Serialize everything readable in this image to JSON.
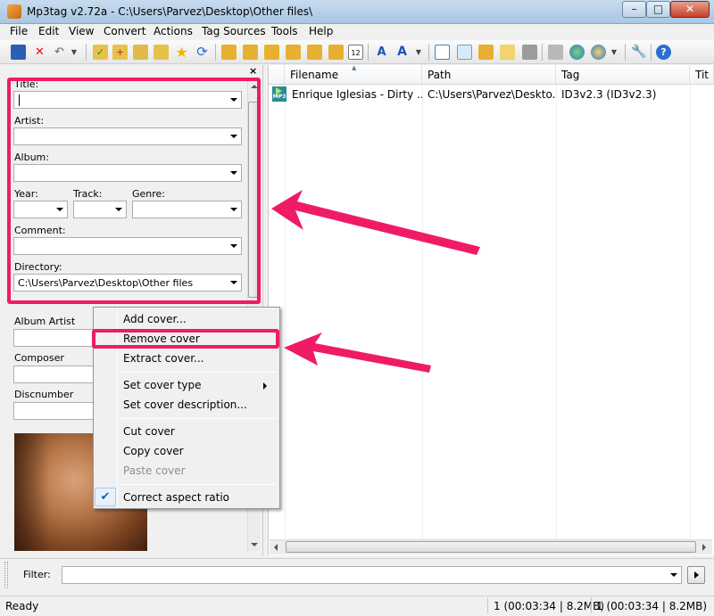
{
  "window": {
    "title": "Mp3tag v2.72a  -  C:\\Users\\Parvez\\Desktop\\Other files\\",
    "minimize_glyph": "–",
    "maximize_glyph": "□",
    "close_glyph": "✕"
  },
  "menu": [
    "File",
    "Edit",
    "View",
    "Convert",
    "Actions",
    "Tag Sources",
    "Tools",
    "Help"
  ],
  "toolbar": {
    "icons": [
      "save-icon",
      "delete-icon",
      "undo-icon",
      "dropdown-icon",
      "refresh-folder-icon",
      "add-folder-icon",
      "tag-icon",
      "export-icon",
      "favorite-icon",
      "refresh-icon",
      "tag-to-filename-icon",
      "filename-to-tag-icon",
      "text-to-tag-icon",
      "tag-to-tag-icon",
      "freedb-icon",
      "case-conversion-icon",
      "text-format-icon",
      "playlist-icon",
      "export-html-icon",
      "import-icon",
      "web-source-icon",
      "web-source2-icon",
      "settings-icon",
      "help-icon"
    ]
  },
  "tag_panel": {
    "close_glyph": "×",
    "labels": {
      "title": "Title:",
      "artist": "Artist:",
      "album": "Album:",
      "year": "Year:",
      "track": "Track:",
      "genre": "Genre:",
      "comment": "Comment:",
      "directory": "Directory:",
      "album_artist": "Album Artist",
      "composer": "Composer",
      "discnumber": "Discnumber"
    },
    "values": {
      "title": "",
      "artist": "",
      "album": "",
      "year": "",
      "track": "",
      "genre": "",
      "comment": "",
      "directory": "C:\\Users\\Parvez\\Desktop\\Other files"
    }
  },
  "file_list": {
    "columns": [
      "Filename",
      "Path",
      "Tag",
      "Tit"
    ],
    "rows": [
      {
        "filename": "Enrique Iglesias - Dirty ...",
        "path": "C:\\Users\\Parvez\\Deskto...",
        "tag": "ID3v2.3 (ID3v2.3)",
        "title": ""
      }
    ],
    "file_type_badge": "MP3"
  },
  "context_menu": {
    "items": [
      {
        "label": "Add cover...",
        "enabled": true
      },
      {
        "label": "Remove cover",
        "enabled": true
      },
      {
        "label": "Extract cover...",
        "enabled": true
      },
      {
        "label": "Set cover type",
        "enabled": true
      },
      {
        "label": "Set cover description...",
        "enabled": true
      },
      {
        "label": "Cut cover",
        "enabled": true
      },
      {
        "label": "Copy cover",
        "enabled": true
      },
      {
        "label": "Paste cover",
        "enabled": false
      },
      {
        "label": "Correct aspect ratio",
        "enabled": true
      }
    ],
    "check_glyph": "✔"
  },
  "filter": {
    "label": "Filter:",
    "value": ""
  },
  "status": {
    "left": "Ready",
    "selected": "1 (00:03:34 | 8.2MB)",
    "total": "1 (00:03:34 | 8.2MB)"
  },
  "colors": {
    "highlight": "#ef1b66",
    "title_bar": "#b9d1ea"
  }
}
